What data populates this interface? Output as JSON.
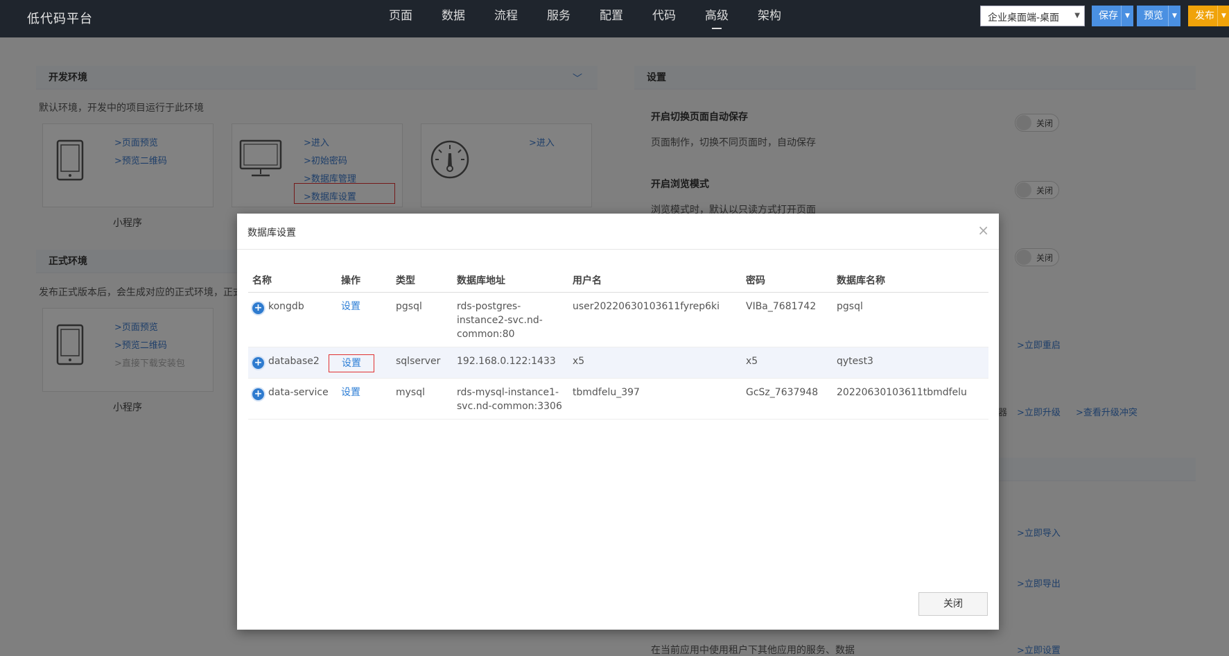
{
  "app": {
    "title": "低代码平台"
  },
  "nav": {
    "items": [
      "页面",
      "数据",
      "流程",
      "服务",
      "配置",
      "代码",
      "高级",
      "架构"
    ],
    "active_index": 6
  },
  "toolbar": {
    "env_select": "企业桌面端-桌面",
    "save": "保存",
    "preview": "预览",
    "publish": "发布"
  },
  "dev_env": {
    "title": "开发环境",
    "desc": "默认环境，开发中的项目运行于此环境",
    "cards": [
      {
        "links": [
          ">页面预览",
          ">预览二维码"
        ],
        "caption": "小程序"
      },
      {
        "links": [
          ">进入",
          ">初始密码",
          ">数据库管理",
          ">数据库设置"
        ]
      },
      {
        "links": [
          ">进入"
        ]
      }
    ]
  },
  "prod_env": {
    "title": "正式环境",
    "desc": "发布正式版本后，会生成对应的正式环境，正式",
    "card": {
      "links": [
        ">页面预览",
        ">预览二维码",
        ">直接下载安装包"
      ],
      "caption": "小程序"
    }
  },
  "settings": {
    "title": "设置",
    "items": [
      {
        "title": "开启切换页面自动保存",
        "desc": "页面制作，切换不同页面时，自动保存",
        "toggle": "关闭"
      },
      {
        "title": "开启浏览模式",
        "desc": "浏览模式时，默认以只读方式打开页面",
        "toggle": "关闭"
      },
      {
        "toggle": "关闭"
      }
    ],
    "links": [
      ">立即重启",
      ">立即升级",
      ">查看升级冲突",
      ">立即导入",
      ">立即导出",
      ">立即设置"
    ],
    "partial_char": "器",
    "bottom_desc": "在当前应用中使用租户下其他应用的服务、数据"
  },
  "modal": {
    "title": "数据库设置",
    "close_label": "关闭",
    "columns": [
      "名称",
      "操作",
      "类型",
      "数据库地址",
      "用户名",
      "密码",
      "数据库名称"
    ],
    "rows": [
      {
        "name": "kongdb",
        "action": "设置",
        "type": "pgsql",
        "address": "rds-postgres-instance2-svc.nd-common:80",
        "username": "user20220630103611fyrep6ki",
        "password": "VIBa_7681742",
        "dbname": "pgsql"
      },
      {
        "name": "database2",
        "action": "设置",
        "type": "sqlserver",
        "address": "192.168.0.122:1433",
        "username": "x5",
        "password": "x5",
        "dbname": "qytest3"
      },
      {
        "name": "data-service",
        "action": "设置",
        "type": "mysql",
        "address": "rds-mysql-instance1-svc.nd-common:3306",
        "username": "tbmdfelu_397",
        "password": "GcSz_7637948",
        "dbname": "20220630103611tbmdfelu"
      }
    ]
  },
  "colors": {
    "topbar": "#1f252d",
    "accent": "#4a90e2",
    "publish": "#f0a30a",
    "highlight_border": "#e03030"
  }
}
